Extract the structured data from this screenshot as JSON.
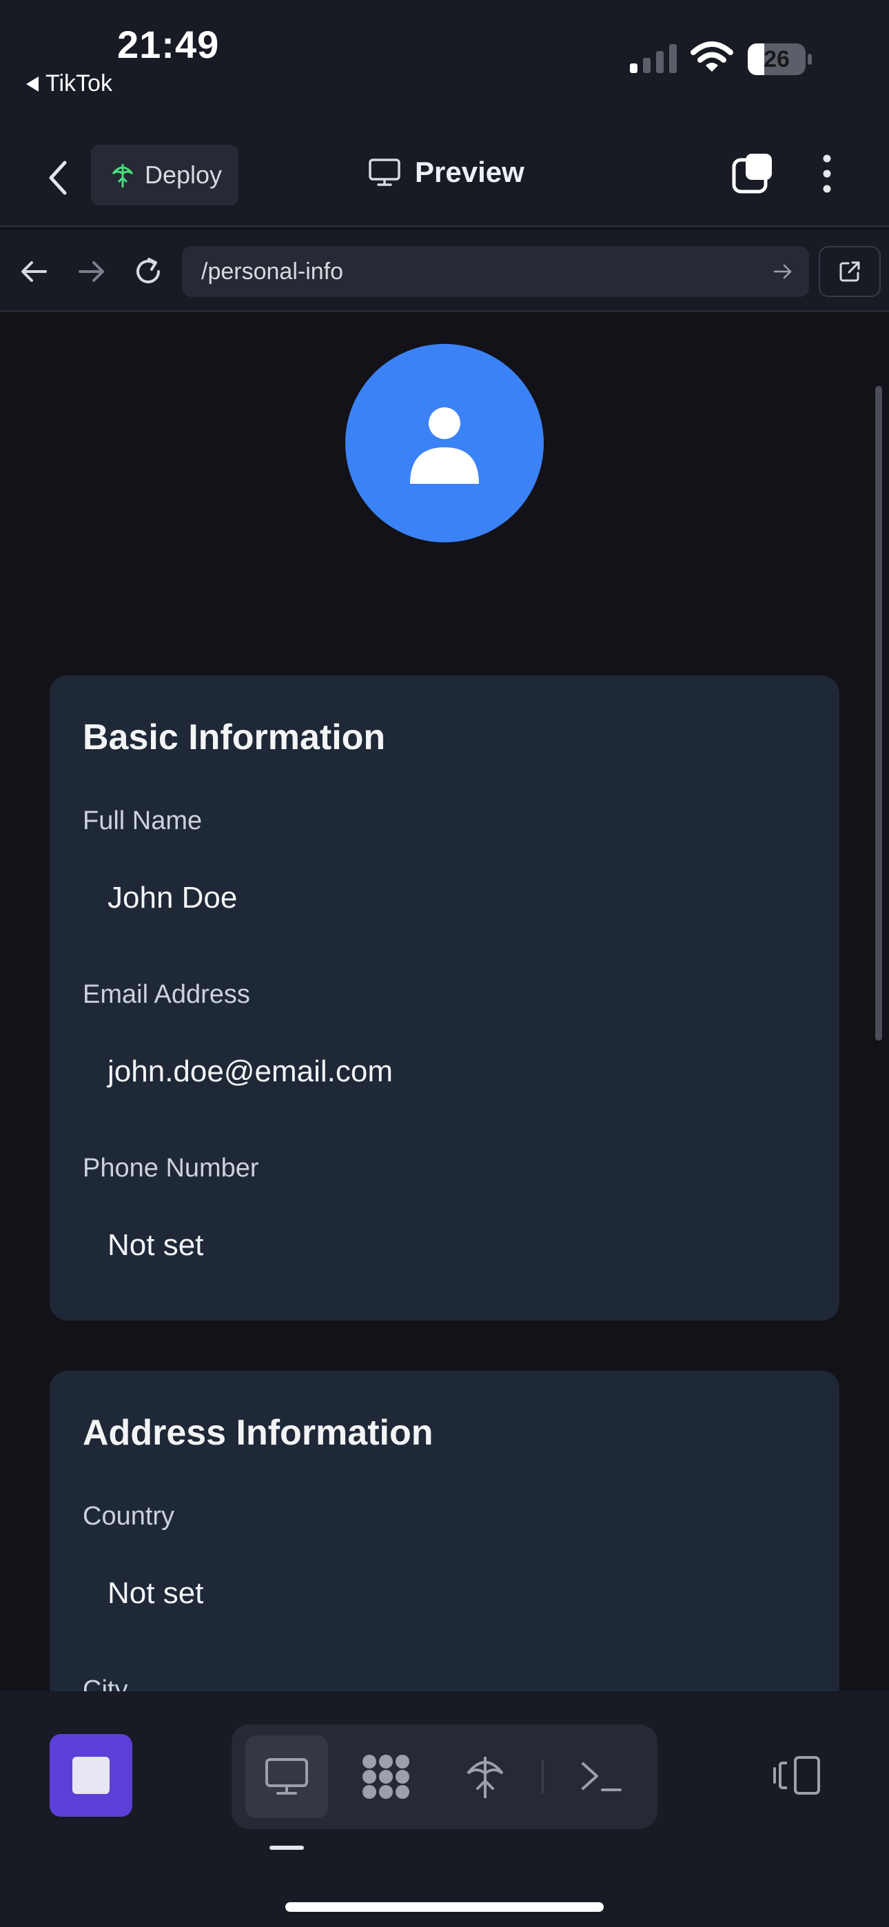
{
  "status_bar": {
    "time": "21:49",
    "back_app": "TikTok",
    "battery": "26"
  },
  "header": {
    "deploy_label": "Deploy",
    "title": "Preview"
  },
  "browser": {
    "url": "/personal-info"
  },
  "basic_info": {
    "title": "Basic Information",
    "fields": [
      {
        "label": "Full Name",
        "value": "John Doe"
      },
      {
        "label": "Email Address",
        "value": "john.doe@email.com"
      },
      {
        "label": "Phone Number",
        "value": "Not set"
      }
    ]
  },
  "address_info": {
    "title": "Address Information",
    "fields": [
      {
        "label": "Country",
        "value": "Not set"
      },
      {
        "label": "City",
        "value": ""
      }
    ]
  },
  "colors": {
    "accent": "#3b82f6",
    "stop_button": "#5b3fd6",
    "card_bg": "#1f2837",
    "deploy_icon": "#4ade80"
  }
}
